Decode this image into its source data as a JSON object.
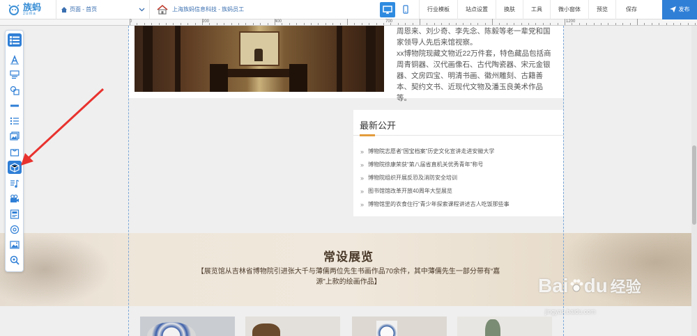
{
  "logo": {
    "cn": "族蚂",
    "en": "zuma"
  },
  "page_selector": {
    "value": "页面 - 首页"
  },
  "company": {
    "name": "上海族蚂信息科技 - 族蚂员工"
  },
  "menu": [
    "行业模板",
    "站点设置",
    "换肤",
    "工具",
    "微小窗体",
    "预览"
  ],
  "save_label": "保存",
  "publish_label": "发布",
  "ruler": {
    "labels": [
      "0",
      "200",
      "400",
      "700",
      "1200"
    ]
  },
  "content": {
    "desc_lines": [
      "周恩来、刘少奇、李先念、陈毅等老一辈党和国",
      "家领导人先后来馆视察。",
      "xx博物院现藏文物近22万件套，特色藏品包括商",
      "周青铜器、汉代画像石、古代陶瓷器、宋元金银",
      "器、文房四宝、明清书画、徽州雕刻、古籍善",
      "本、契约文书、近现代文物及潘玉良美术作品",
      "等。"
    ],
    "news_title": "最新公开",
    "news": [
      "博物院志愿者“国宝档案”历史文化宣讲走进安徽大学",
      "博物院徐康荣获“第八届省直机关优秀青年”称号",
      "博物院组织开展反恐及消防安全培训",
      "图书馆馆改革开放40周年大型展览",
      "博物馆里的衣食住行”青少年探索课程讲述古人吃饭那些事"
    ],
    "exhibit_title": "常设展览",
    "exhibit_sub": "【展览馆从吉林省博物院引进张大千与薄儒两位先生书画作品70余件，其中薄儒先生一部分带有“嘉源”上款的绘画作品】"
  },
  "watermark": {
    "bai": "Bai",
    "du": "du",
    "jingyan": "经验",
    "url": "jingyan.baidu.com"
  },
  "colors": {
    "accent": "#2f7fd6",
    "news_accent": "#e39b3c"
  }
}
